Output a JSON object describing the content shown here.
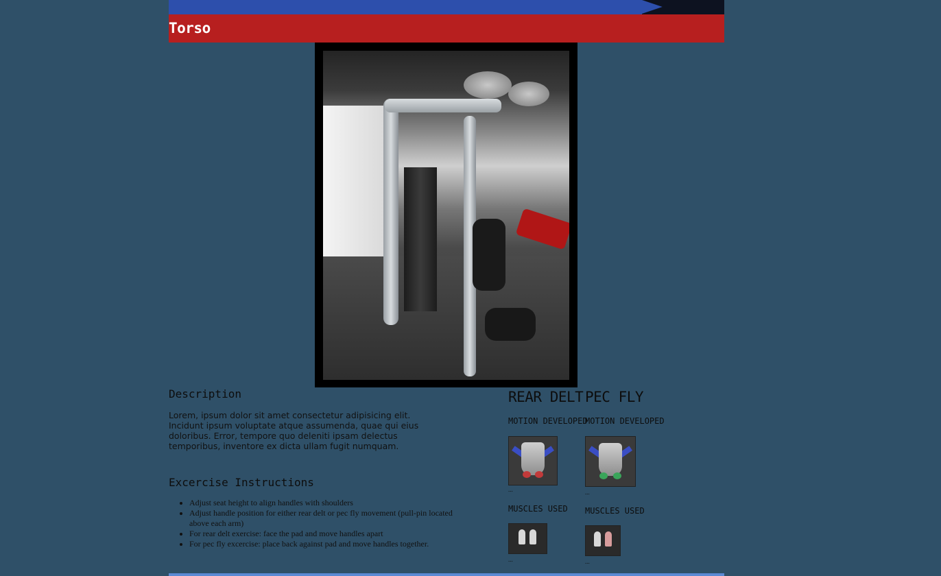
{
  "header": {
    "title": "Torso"
  },
  "description": {
    "heading": "Description",
    "text": "Lorem, ipsum dolor sit amet consectetur adipisicing elit. Incidunt ipsum voluptate atque assumenda, quae qui eius doloribus. Error, tempore quo deleniti ipsam delectus temporibus, inventore ex dicta ullam fugit numquam."
  },
  "instructions": {
    "heading": "Excercise Instructions",
    "items": [
      "Adjust seat height to align handles with shoulders",
      "Adjust handle position for either rear delt or pec fly movement (pull-pin located above each arm)",
      "For rear delt exercise: face the pad and move handles apart",
      "For pec fly excercise: place back against pad and move handles together."
    ]
  },
  "exercises": [
    {
      "name": "REAR DELT",
      "motion_heading": "MOTION DEVELOPED",
      "motion_caption": "...",
      "muscles_heading": "MUSCLES USED",
      "muscles_caption": "..."
    },
    {
      "name": "PEC FLY",
      "motion_heading": "MOTION DEVELOPED",
      "motion_caption": "...",
      "muscles_heading": "MUSCLES USED",
      "muscles_caption": "..."
    }
  ],
  "colors": {
    "background": "#2f5068",
    "header_red": "#b71f1f",
    "top_bar_blue": "#2d4fac"
  }
}
